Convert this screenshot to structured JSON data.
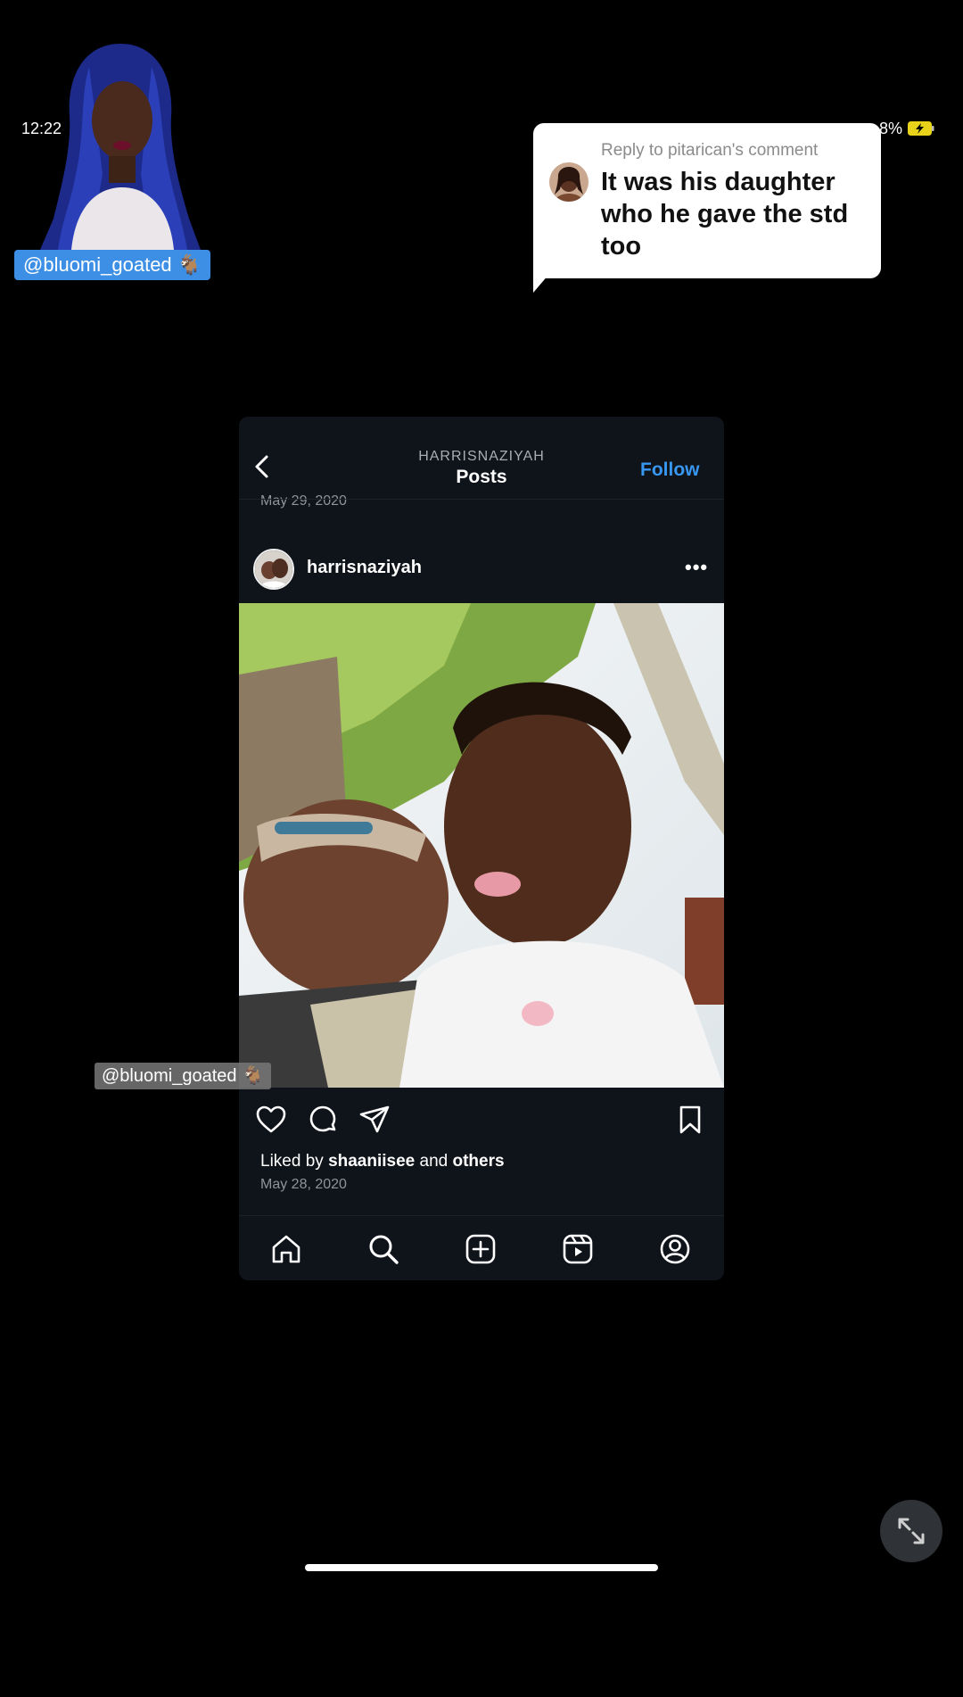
{
  "status_bar": {
    "time": "12:22",
    "battery_text": "8%",
    "battery_charging": true
  },
  "creator": {
    "handle": "@bluomi_goated 🐐",
    "watermark_handle": "@bluomi_goated 🐐"
  },
  "reply": {
    "header": "Reply to pitarican's comment",
    "comment": "It was his daughter who he gave the std too"
  },
  "instagram": {
    "nav": {
      "username": "HARRISNAZIYAH",
      "title": "Posts",
      "follow_label": "Follow"
    },
    "previous_post_date": "May 29, 2020",
    "post": {
      "username": "harrisnaziyah",
      "more_label": "•••",
      "liked_by_prefix": "Liked by",
      "liked_by_user": "shaaniisee",
      "liked_by_and": "and",
      "liked_by_others": "others",
      "date": "May 28, 2020"
    },
    "tabs": [
      "home-icon",
      "search-icon",
      "create-icon",
      "reels-icon",
      "profile-icon"
    ]
  },
  "colors": {
    "follow": "#3897f0",
    "handle_badge": "#3d8fe6",
    "background": "#000000",
    "phone_bg": "#0f131a"
  }
}
